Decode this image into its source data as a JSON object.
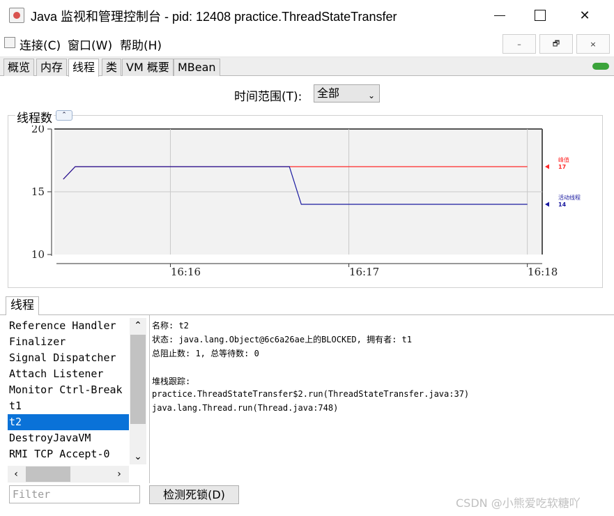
{
  "window": {
    "title": "Java 监视和管理控制台 - pid: 12408 practice.ThreadStateTransfer",
    "minimize_glyph": "",
    "close_glyph": "✕"
  },
  "menu": {
    "items": [
      "连接(C)",
      "窗口(W)",
      "帮助(H)"
    ],
    "mdi_min": "–",
    "mdi_restore": "🗗",
    "mdi_close": "×"
  },
  "tabs": [
    "概览",
    "内存",
    "线程",
    "类",
    "VM 概要",
    "MBean"
  ],
  "active_tab": "线程",
  "time_range": {
    "label": "时间范围(T):",
    "value": "全部"
  },
  "chart_section": {
    "title": "线程数",
    "collapse_glyph": "⌃"
  },
  "chart_data": {
    "type": "line",
    "ylim": [
      10,
      20
    ],
    "y_ticks": [
      "20",
      "15",
      "10"
    ],
    "x_ticks": [
      "16:16",
      "16:17",
      "16:18"
    ],
    "series": [
      {
        "name": "峰值",
        "latest": "17",
        "color": "#ff2a2a",
        "points": [
          [
            "16:15:24",
            16
          ],
          [
            "16:15:28",
            17
          ],
          [
            "16:18:00",
            17
          ]
        ]
      },
      {
        "name": "活动线程",
        "latest": "14",
        "color": "#1a1aa0",
        "points": [
          [
            "16:15:24",
            16
          ],
          [
            "16:15:28",
            17
          ],
          [
            "16:16:40",
            17
          ],
          [
            "16:16:44",
            14
          ],
          [
            "16:18:00",
            14
          ]
        ]
      }
    ]
  },
  "threads_section": {
    "tab_label": "线程"
  },
  "threads": [
    "Reference Handler",
    "Finalizer",
    "Signal Dispatcher",
    "Attach Listener",
    "Monitor Ctrl-Break",
    "t1",
    "t2",
    "DestroyJavaVM",
    "RMI TCP Accept-0"
  ],
  "selected_thread": "t2",
  "detail": {
    "name_line": "名称: t2",
    "state_line": "状态: java.lang.Object@6c6a26ae上的BLOCKED, 拥有者: t1",
    "counts_line": "总阻止数: 1, 总等待数: 0",
    "stack_title": "堆栈跟踪:",
    "stack": [
      "practice.ThreadStateTransfer$2.run(ThreadStateTransfer.java:37)",
      "java.lang.Thread.run(Thread.java:748)"
    ]
  },
  "filter": {
    "placeholder": "Filter"
  },
  "deadlock_button": "检测死锁(D)",
  "watermark": "CSDN @小熊爱吃软糖吖",
  "scroll_glyphs": {
    "up": "⌃",
    "down": "⌄",
    "left": "‹",
    "right": "›"
  }
}
